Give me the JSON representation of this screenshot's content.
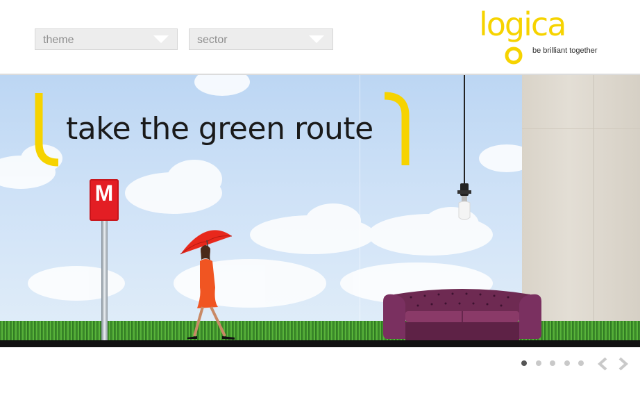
{
  "filters": {
    "theme_label": "theme",
    "sector_label": "sector"
  },
  "brand": {
    "logo_text": "logica",
    "tagline": "be brilliant together",
    "accent_color": "#f6d300"
  },
  "hero": {
    "headline": "take the green route",
    "metro_sign": "M"
  },
  "pager": {
    "slide_count": 5,
    "active_index": 0
  },
  "icons": [
    "chevron-down-icon",
    "chevron-left-icon",
    "chevron-right-icon"
  ]
}
